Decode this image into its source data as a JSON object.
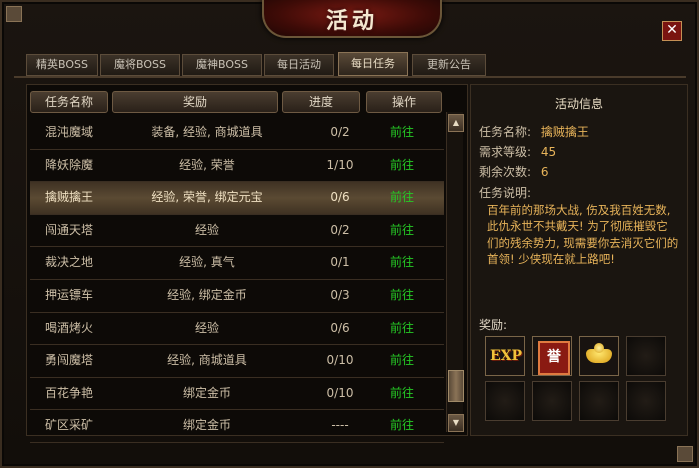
{
  "window": {
    "title": "活动",
    "close_label": "✕"
  },
  "tabs": [
    {
      "label": "精英BOSS",
      "active": false
    },
    {
      "label": "魔将BOSS",
      "active": false
    },
    {
      "label": "魔神BOSS",
      "active": false
    },
    {
      "label": "每日活动",
      "active": false
    },
    {
      "label": "每日任务",
      "active": true
    },
    {
      "label": "更新公告",
      "active": false
    }
  ],
  "table": {
    "headers": {
      "name": "任务名称",
      "reward": "奖励",
      "progress": "进度",
      "action": "操作"
    },
    "rows": [
      {
        "name": "混沌魔域",
        "reward": "装备, 经验, 商城道具",
        "progress": "0/2",
        "action": "前往"
      },
      {
        "name": "降妖除魔",
        "reward": "经验, 荣誉",
        "progress": "1/10",
        "action": "前往"
      },
      {
        "name": "擒贼擒王",
        "reward": "经验, 荣誉, 绑定元宝",
        "progress": "0/6",
        "action": "前往",
        "selected": true
      },
      {
        "name": "闯通天塔",
        "reward": "经验",
        "progress": "0/2",
        "action": "前往"
      },
      {
        "name": "裁决之地",
        "reward": "经验, 真气",
        "progress": "0/1",
        "action": "前往"
      },
      {
        "name": "押运镖车",
        "reward": "经验, 绑定金币",
        "progress": "0/3",
        "action": "前往"
      },
      {
        "name": "喝酒烤火",
        "reward": "经验",
        "progress": "0/6",
        "action": "前往"
      },
      {
        "name": "勇闯魔塔",
        "reward": "经验, 商城道具",
        "progress": "0/10",
        "action": "前往"
      },
      {
        "name": "百花争艳",
        "reward": "绑定金币",
        "progress": "0/10",
        "action": "前往"
      },
      {
        "name": "矿区采矿",
        "reward": "绑定金币",
        "progress": "----",
        "action": "前往"
      }
    ]
  },
  "scrollbar": {
    "up": "▲",
    "down": "▼"
  },
  "info": {
    "title": "活动信息",
    "name_label": "任务名称:",
    "name_value": "擒贼擒王",
    "level_label": "需求等级:",
    "level_value": "45",
    "remain_label": "剩余次数:",
    "remain_value": "6",
    "desc_label": "任务说明:",
    "desc": "百年前的那场大战, 伤及我百姓无数, 此仇永世不共戴天! 为了彻底摧毁它们的残余势力, 现需要你去消灭它们的首领! 少侠现在就上路吧!",
    "reward_label": "奖励:",
    "rewards": [
      {
        "icon": "exp-icon",
        "text": "EXP"
      },
      {
        "icon": "honor-medal-icon",
        "text": "誉"
      },
      {
        "icon": "gold-ingot-icon",
        "text": ""
      }
    ]
  }
}
